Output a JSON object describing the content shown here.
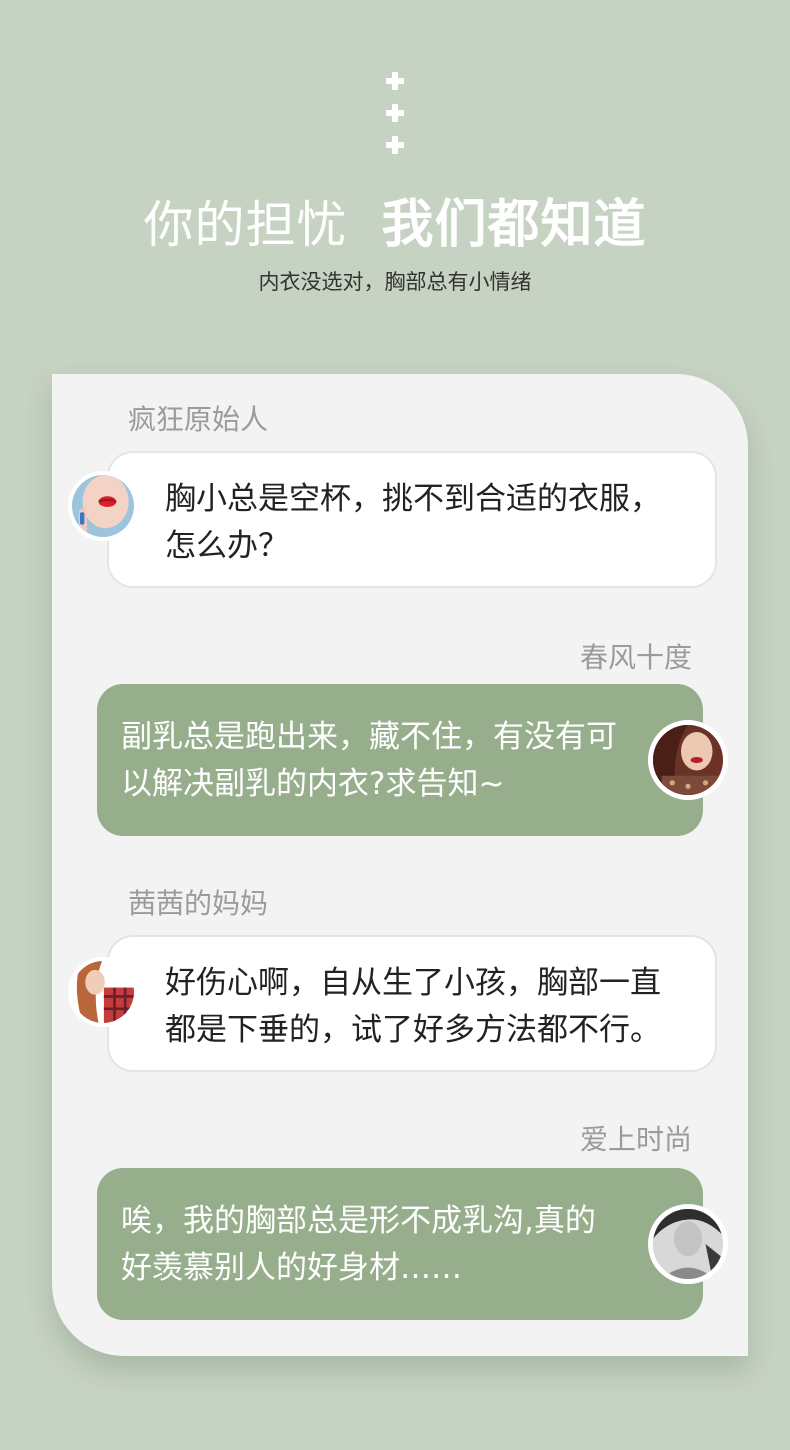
{
  "header": {
    "title_light": "你的担忧",
    "title_bold": "我们都知道",
    "subtitle": "内衣没选对，胸部总有小情绪"
  },
  "chat": [
    {
      "name": "疯狂原始人",
      "side": "left",
      "lines": [
        "胸小总是空杯，挑不到合适的衣服，",
        "怎么办？"
      ],
      "avatar_icon": "red-lips-avatar"
    },
    {
      "name": "春风十度",
      "side": "right",
      "lines": [
        "副乳总是跑出来，藏不住，有没有可",
        "以解决副乳的内衣?求告知~"
      ],
      "avatar_icon": "red-hair-avatar"
    },
    {
      "name": "茜茜的妈妈",
      "side": "left",
      "lines": [
        "好伤心啊，自从生了小孩，胸部一直",
        "都是下垂的，试了好多方法都不行。"
      ],
      "avatar_icon": "plaid-shirt-avatar"
    },
    {
      "name": "爱上时尚",
      "side": "right",
      "lines": [
        "唉，我的胸部总是形不成乳沟,真的",
        "好羡慕别人的好身材……"
      ],
      "avatar_icon": "monochrome-portrait-avatar"
    }
  ],
  "colors": {
    "background": "#c6d2c2",
    "card": "#f3f3f3",
    "bubble_green": "#97ae8d",
    "bubble_white": "#ffffff",
    "name_gray": "#9b9b9b"
  }
}
